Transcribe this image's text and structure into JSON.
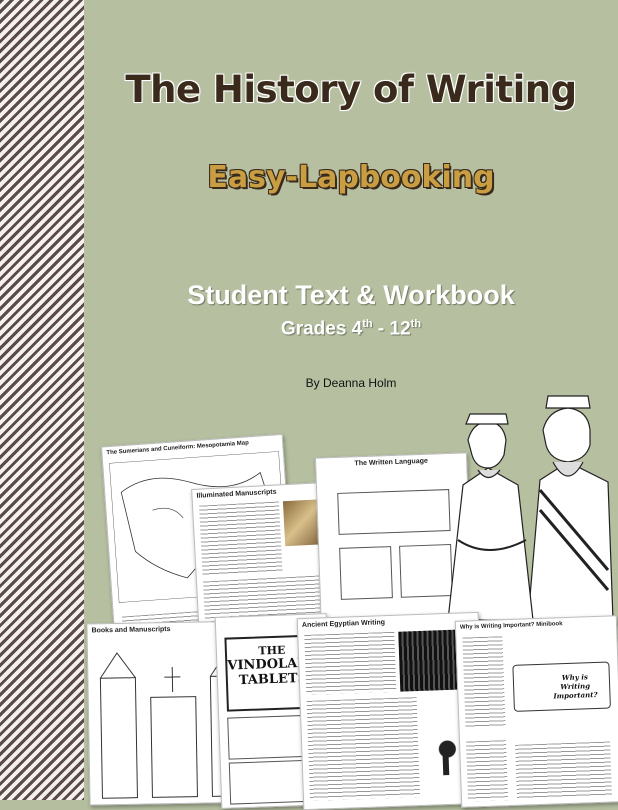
{
  "cover": {
    "title": "The History of Writing",
    "subtitle": "Easy-Lapbooking",
    "workbook": "Student Text & Workbook",
    "grades_prefix": "Grades 4",
    "grades_sup1": "th",
    "grades_mid": " - 12",
    "grades_sup2": "th",
    "author": "By Deanna Holm"
  },
  "preview_pages": {
    "map_page_title": "The Sumerians and Cuneiform: Mesopotamia Map",
    "manuscripts_title": "Illuminated Manuscripts",
    "written_language_title": "The Written Language",
    "books_title": "Books and Manuscripts",
    "vindolanda_line1": "THE",
    "vindolanda_line2": "VINDOLANDA",
    "vindolanda_line3": "TABLETS",
    "egyptian_title": "Ancient Egyptian Writing",
    "why_title": "Why is Writing Important? Minibook",
    "why_label": "Why is Writing Important?"
  },
  "colors": {
    "background": "#b6c0a1",
    "title": "#3a2a1c",
    "subtitle": "#c99d42",
    "stripe": "#5a4a48"
  }
}
